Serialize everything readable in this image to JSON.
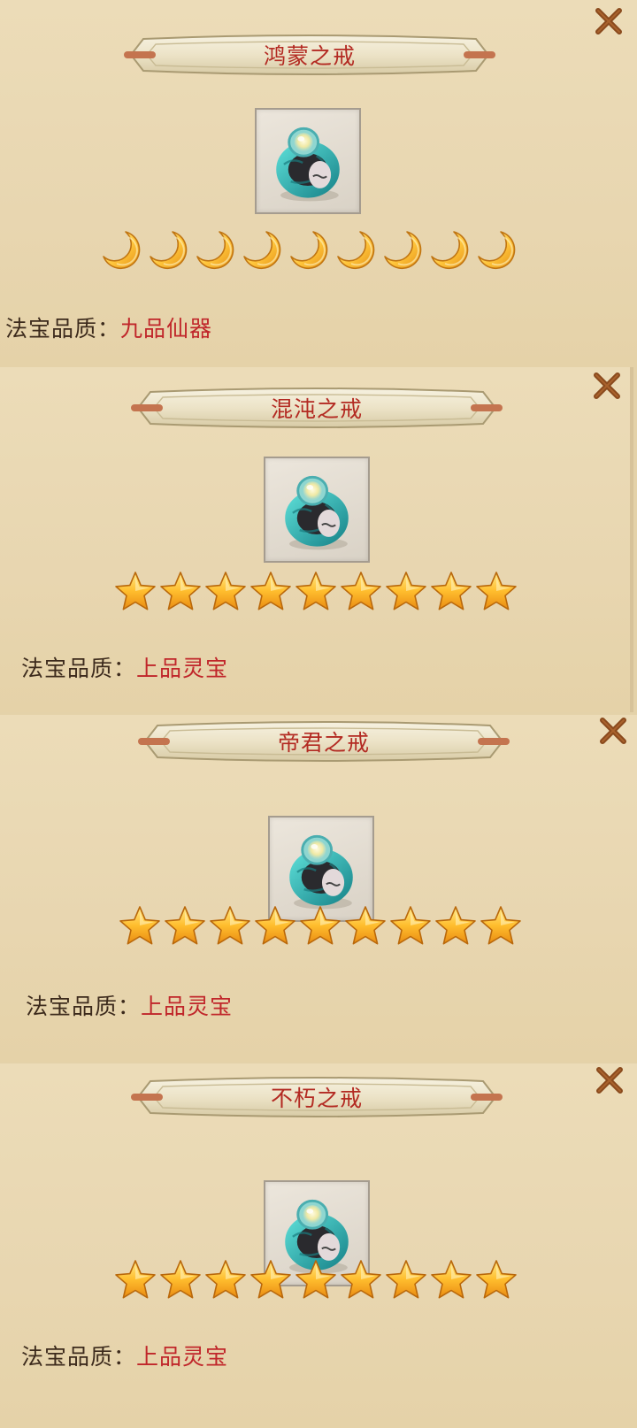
{
  "colors": {
    "title": "#b32a22",
    "label": "#3c2a1c",
    "value": "#c0262a",
    "close": "#8a4a1d"
  },
  "items": [
    {
      "name": "鸿蒙之戒",
      "rating_icon": "moon-icon",
      "rating_count": 9,
      "quality_label": "法宝品质：",
      "quality_value": "九品仙器"
    },
    {
      "name": "混沌之戒",
      "rating_icon": "star-icon",
      "rating_count": 9,
      "quality_label": "法宝品质：",
      "quality_value": "上品灵宝"
    },
    {
      "name": "帝君之戒",
      "rating_icon": "star-icon",
      "rating_count": 9,
      "quality_label": "法宝品质：",
      "quality_value": "上品灵宝"
    },
    {
      "name": "不朽之戒",
      "rating_icon": "star-icon",
      "rating_count": 9,
      "quality_label": "法宝品质：",
      "quality_value": "上品灵宝"
    }
  ]
}
